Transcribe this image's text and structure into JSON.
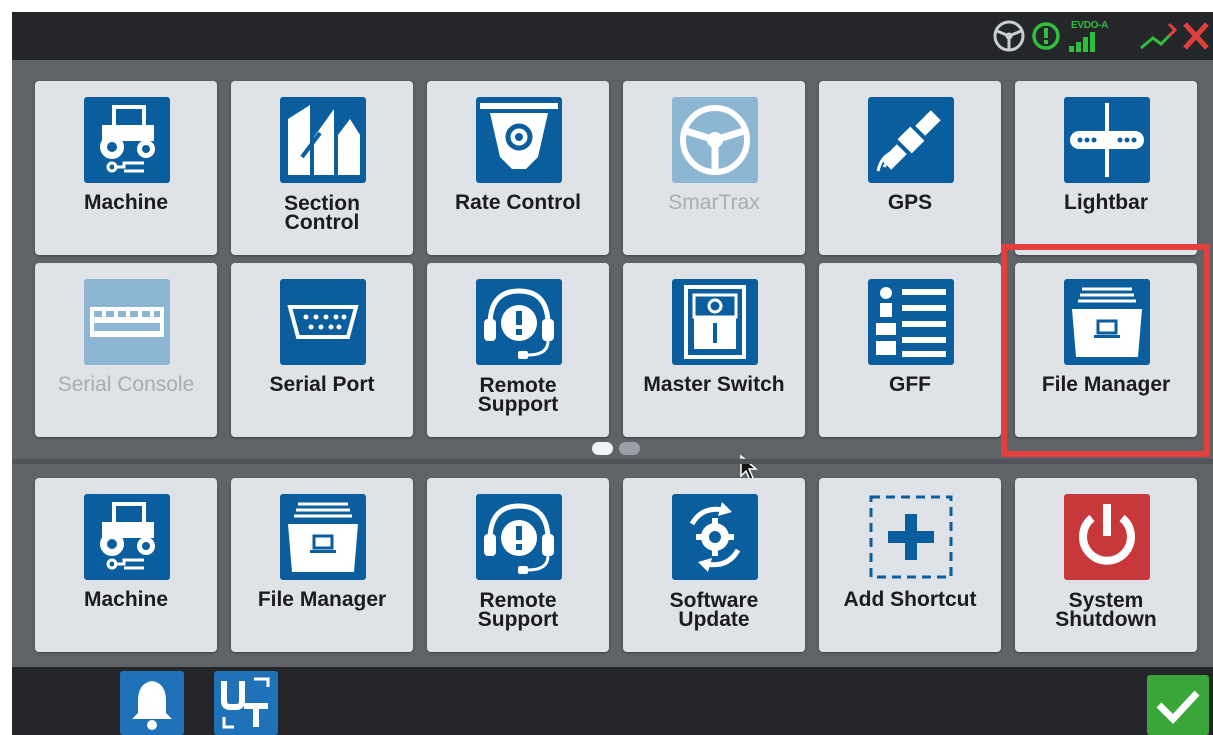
{
  "status_bar": {
    "icons": [
      "steering-wheel-icon",
      "alert-icon",
      "cell-signal-icon",
      "satellite-icon",
      "no-connection-icon"
    ],
    "network_label": "EVDO-A",
    "colors": {
      "ok": "#2fbf3a",
      "error": "#e2403f"
    }
  },
  "page_tiles": [
    {
      "label": "Machine",
      "icon": "tractor-icon",
      "enabled": true
    },
    {
      "label": "Section\nControl",
      "icon": "section-control-icon",
      "enabled": true
    },
    {
      "label": "Rate Control",
      "icon": "rate-control-icon",
      "enabled": true
    },
    {
      "label": "SmarTrax",
      "icon": "steering-wheel-icon",
      "enabled": false
    },
    {
      "label": "GPS",
      "icon": "satellite-icon",
      "enabled": true
    },
    {
      "label": "Lightbar",
      "icon": "lightbar-icon",
      "enabled": true
    },
    {
      "label": "Serial Console",
      "icon": "serial-console-icon",
      "enabled": false
    },
    {
      "label": "Serial Port",
      "icon": "serial-port-icon",
      "enabled": true
    },
    {
      "label": "Remote\nSupport",
      "icon": "headset-icon",
      "enabled": true
    },
    {
      "label": "Master Switch",
      "icon": "master-switch-icon",
      "enabled": true
    },
    {
      "label": "GFF",
      "icon": "gff-list-icon",
      "enabled": true
    },
    {
      "label": "File Manager",
      "icon": "file-box-icon",
      "enabled": true,
      "highlighted": true
    }
  ],
  "pagination": {
    "pages": 2,
    "current": 1
  },
  "shortcuts": [
    {
      "label": "Machine",
      "icon": "tractor-icon"
    },
    {
      "label": "File Manager",
      "icon": "file-box-icon"
    },
    {
      "label": "Remote\nSupport",
      "icon": "headset-icon"
    },
    {
      "label": "Software\nUpdate",
      "icon": "software-update-icon"
    },
    {
      "label": "Add Shortcut",
      "icon": "add-plus-icon"
    },
    {
      "label": "System\nShutdown",
      "icon": "power-icon"
    }
  ],
  "bottom_bar": {
    "buttons": [
      {
        "name": "notifications-button",
        "icon": "bell-icon"
      },
      {
        "name": "universal-terminal-button",
        "icon": "ut-icon"
      },
      {
        "name": "confirm-button",
        "icon": "checkmark-icon"
      }
    ]
  },
  "colors": {
    "icon_blue": "#0b5e9e",
    "icon_blue_disabled": "#8db6d3",
    "tile_bg": "#dfe3e8",
    "highlight_red": "#e2403f",
    "shutdown_red": "#c8383a",
    "confirm_green": "#3aa63a"
  }
}
